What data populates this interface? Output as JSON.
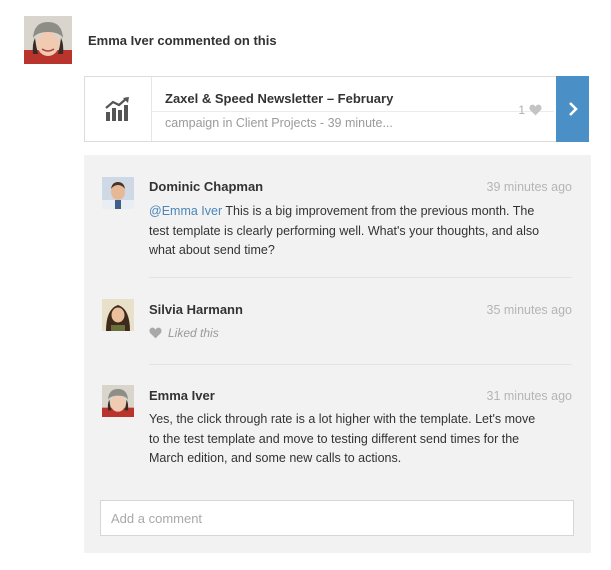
{
  "activity": {
    "actor": "Emma Iver",
    "title": "Emma Iver commented on this"
  },
  "campaign": {
    "icon": "bar-chart-trend-icon",
    "title": "Zaxel & Speed Newsletter – February",
    "subtitle": "campaign in Client Projects - 39 minute...",
    "like_count": "1",
    "arrow_icon": "chevron-right-icon"
  },
  "comments": [
    {
      "author": "Dominic Chapman",
      "time": "39 minutes ago",
      "mention": "@Emma Iver",
      "text": " This is a big improvement from the previous month. The test template is clearly performing well. What's your thoughts, and also what about send time?"
    },
    {
      "author": "Silvia Harmann",
      "time": "35 minutes ago",
      "liked_text": "Liked this"
    },
    {
      "author": "Emma Iver",
      "time": "31 minutes ago",
      "text": "Yes, the click through rate is a lot higher with the template. Let's move to the test template and move to testing different send times for the March edition, and some new calls to actions."
    }
  ],
  "composer": {
    "placeholder": "Add a comment",
    "value": ""
  },
  "colors": {
    "accent": "#4a8fc6",
    "mention": "#4a86b8",
    "panel_bg": "#f2f2f2"
  }
}
